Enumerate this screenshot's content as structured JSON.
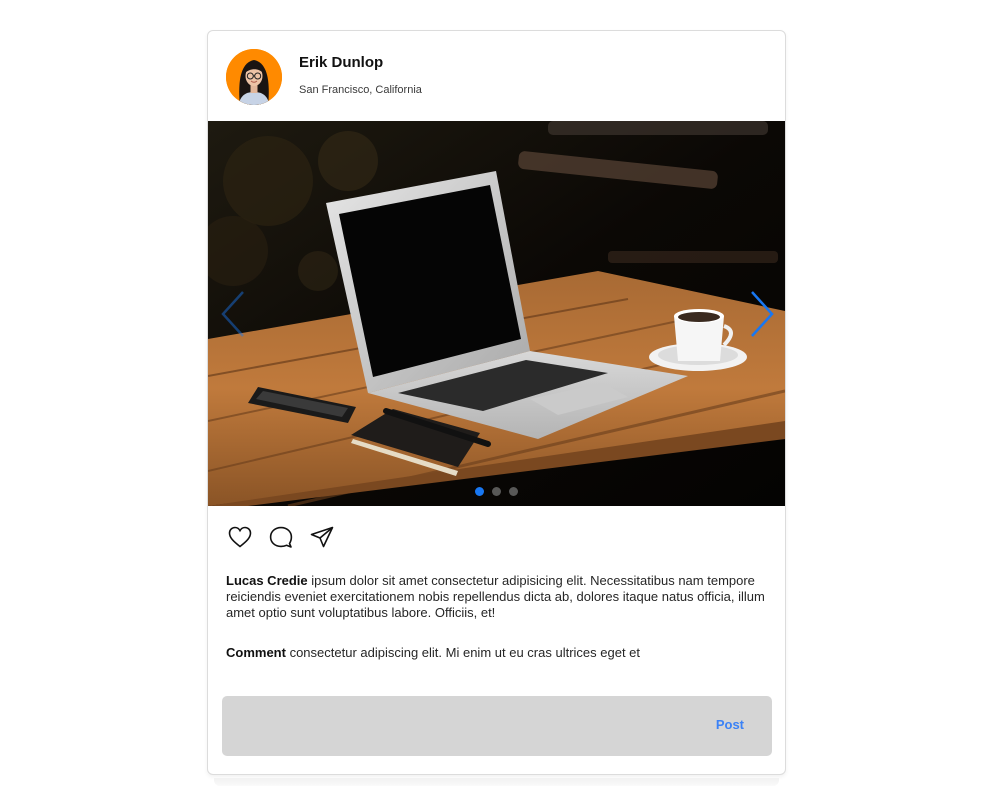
{
  "post": {
    "user": {
      "name": "Erik Dunlop",
      "location": "San Francisco, California",
      "avatar_bg": "#ff8a00"
    },
    "carousel": {
      "slide_count": 3,
      "active_slide": 1,
      "active_dot_color": "#1877f2",
      "prev_icon": "chevron-left-icon",
      "next_icon": "chevron-right-icon"
    },
    "actions": {
      "like_icon": "heart-icon",
      "comment_icon": "speech-bubble-icon",
      "share_icon": "paper-plane-icon"
    },
    "caption": {
      "author": "Lucas Credie",
      "text": " ipsum dolor sit amet consectetur adipisicing elit. Necessitatibus nam tempore reiciendis eveniet exercitationem nobis repellendus dicta ab, dolores itaque natus officia, illum amet optio sunt voluptatibus labore. Officiis, et!"
    },
    "comment": {
      "author": "Comment",
      "text": " consectetur adipiscing elit. Mi enim ut eu cras ultrices eget et"
    },
    "input": {
      "placeholder": "",
      "value": "",
      "post_label": "Post",
      "post_color": "#3b82f6",
      "bar_color": "#d5d5d5"
    }
  }
}
